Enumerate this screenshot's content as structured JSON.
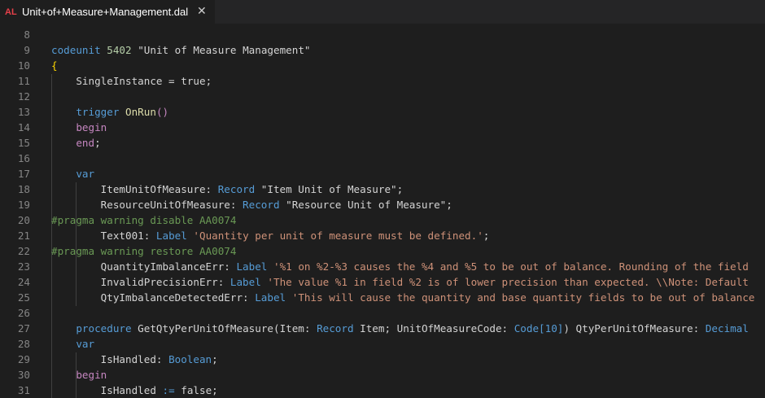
{
  "tab": {
    "icon_text": "AL",
    "title": "Unit+of+Measure+Management.dal",
    "close_symbol": "✕"
  },
  "lines": [
    {
      "n": "8",
      "tokens": []
    },
    {
      "n": "9",
      "tokens": [
        [
          "kw",
          "codeunit"
        ],
        [
          "p",
          " "
        ],
        [
          "num",
          "5402"
        ],
        [
          "p",
          " \"Unit of Measure Management\""
        ]
      ]
    },
    {
      "n": "10",
      "tokens": [
        [
          "brace",
          "{"
        ]
      ]
    },
    {
      "n": "11",
      "tokens": [
        [
          "p",
          "    SingleInstance = "
        ],
        [
          "p",
          "true"
        ],
        [
          "p",
          ";"
        ]
      ]
    },
    {
      "n": "12",
      "tokens": []
    },
    {
      "n": "13",
      "tokens": [
        [
          "p",
          "    "
        ],
        [
          "kw",
          "trigger"
        ],
        [
          "p",
          " "
        ],
        [
          "fn",
          "OnRun"
        ],
        [
          "ctl",
          "()"
        ]
      ]
    },
    {
      "n": "14",
      "tokens": [
        [
          "p",
          "    "
        ],
        [
          "ctl",
          "begin"
        ]
      ]
    },
    {
      "n": "15",
      "tokens": [
        [
          "p",
          "    "
        ],
        [
          "ctl",
          "end"
        ],
        [
          "p",
          ";"
        ]
      ]
    },
    {
      "n": "16",
      "tokens": []
    },
    {
      "n": "17",
      "tokens": [
        [
          "p",
          "    "
        ],
        [
          "kw",
          "var"
        ]
      ]
    },
    {
      "n": "18",
      "tokens": [
        [
          "p",
          "        ItemUnitOfMeasure: "
        ],
        [
          "kw",
          "Record"
        ],
        [
          "p",
          " \"Item Unit of Measure\";"
        ]
      ]
    },
    {
      "n": "19",
      "tokens": [
        [
          "p",
          "        ResourceUnitOfMeasure: "
        ],
        [
          "kw",
          "Record"
        ],
        [
          "p",
          " \"Resource Unit of Measure\";"
        ]
      ]
    },
    {
      "n": "20",
      "tokens": [
        [
          "cmt",
          "#pragma warning disable AA0074"
        ]
      ]
    },
    {
      "n": "21",
      "tokens": [
        [
          "p",
          "        Text001: "
        ],
        [
          "kw",
          "Label"
        ],
        [
          "p",
          " "
        ],
        [
          "str",
          "'Quantity per unit of measure must be defined.'"
        ],
        [
          "p",
          ";"
        ]
      ]
    },
    {
      "n": "22",
      "tokens": [
        [
          "cmt",
          "#pragma warning restore AA0074"
        ]
      ]
    },
    {
      "n": "23",
      "tokens": [
        [
          "p",
          "        QuantityImbalanceErr: "
        ],
        [
          "kw",
          "Label"
        ],
        [
          "p",
          " "
        ],
        [
          "str",
          "'%1 on %2-%3 causes the %4 and %5 to be out of balance. Rounding of the field"
        ]
      ]
    },
    {
      "n": "24",
      "tokens": [
        [
          "p",
          "        InvalidPrecisionErr: "
        ],
        [
          "kw",
          "Label"
        ],
        [
          "p",
          " "
        ],
        [
          "str",
          "'The value %1 in field %2 is of lower precision than expected. \\\\Note: Default"
        ]
      ]
    },
    {
      "n": "25",
      "tokens": [
        [
          "p",
          "        QtyImbalanceDetectedErr: "
        ],
        [
          "kw",
          "Label"
        ],
        [
          "p",
          " "
        ],
        [
          "str",
          "'This will cause the quantity and base quantity fields to be out of balance"
        ]
      ]
    },
    {
      "n": "26",
      "tokens": []
    },
    {
      "n": "27",
      "tokens": [
        [
          "p",
          "    "
        ],
        [
          "kw",
          "procedure"
        ],
        [
          "p",
          " GetQtyPerUnitOfMeasure(Item: "
        ],
        [
          "kw",
          "Record"
        ],
        [
          "p",
          " Item; UnitOfMeasureCode: "
        ],
        [
          "kw",
          "Code[10]"
        ],
        [
          "p",
          ") QtyPerUnitOfMeasure: "
        ],
        [
          "kw",
          "Decimal"
        ]
      ]
    },
    {
      "n": "28",
      "tokens": [
        [
          "p",
          "    "
        ],
        [
          "kw",
          "var"
        ]
      ]
    },
    {
      "n": "29",
      "tokens": [
        [
          "p",
          "        IsHandled: "
        ],
        [
          "kw",
          "Boolean"
        ],
        [
          "p",
          ";"
        ]
      ]
    },
    {
      "n": "30",
      "tokens": [
        [
          "p",
          "    "
        ],
        [
          "ctl",
          "begin"
        ]
      ]
    },
    {
      "n": "31",
      "tokens": [
        [
          "p",
          "        IsHandled "
        ],
        [
          "kw",
          ":="
        ],
        [
          "p",
          " false;"
        ]
      ]
    }
  ]
}
